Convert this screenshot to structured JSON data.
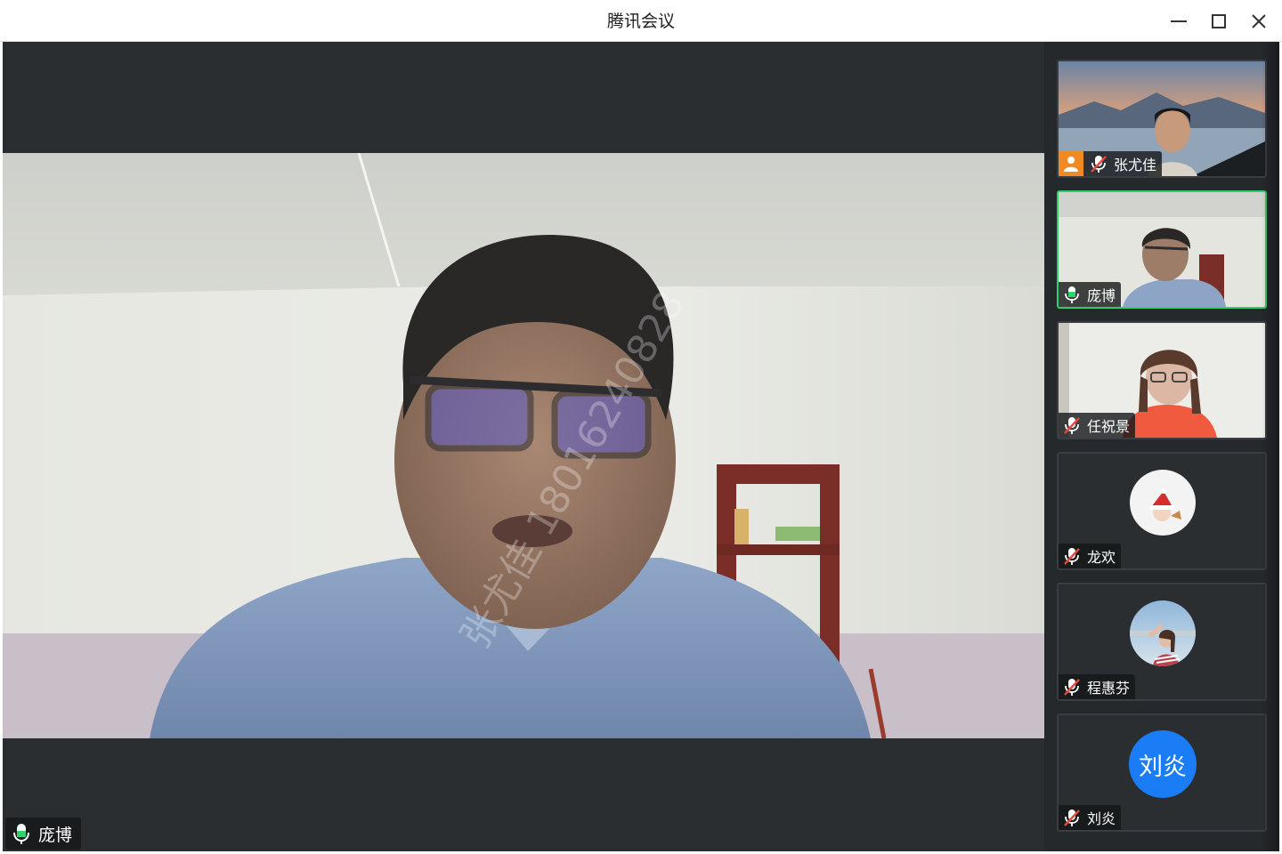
{
  "window": {
    "title": "腾讯会议",
    "controls": [
      "minimize-icon",
      "maximize-icon",
      "close-icon"
    ]
  },
  "main_view": {
    "speaker_name": "庞博",
    "speaker_mic": "mic-on-icon",
    "watermark": "张尤佳 18016240828"
  },
  "participants": [
    {
      "name": "张尤佳",
      "mic": "mic-muted-icon",
      "host": true,
      "host_icon": "host-icon",
      "video": "landscape-background-woman"
    },
    {
      "name": "庞博",
      "mic": "mic-on-icon",
      "host": false,
      "speaking": true,
      "video": "man-with-glasses"
    },
    {
      "name": "任祝景",
      "mic": "mic-muted-icon",
      "host": false,
      "video": "woman-with-glasses-orange-top"
    },
    {
      "name": "龙欢",
      "mic": "mic-muted-icon",
      "host": false,
      "avatar": "christmas-hat-avatar"
    },
    {
      "name": "程惠芬",
      "mic": "mic-muted-icon",
      "host": false,
      "avatar": "photo-avatar"
    },
    {
      "name": "刘炎",
      "mic": "mic-muted-icon",
      "host": false,
      "avatar_text": "刘炎"
    }
  ],
  "colors": {
    "background": "#2b2e31",
    "active_speaker_border": "#2ccf6a",
    "mic_on": "#31d46b",
    "mic_muted": "#e5483f",
    "host_badge": "#f08a24",
    "avatar_blue": "#1a7df5"
  }
}
